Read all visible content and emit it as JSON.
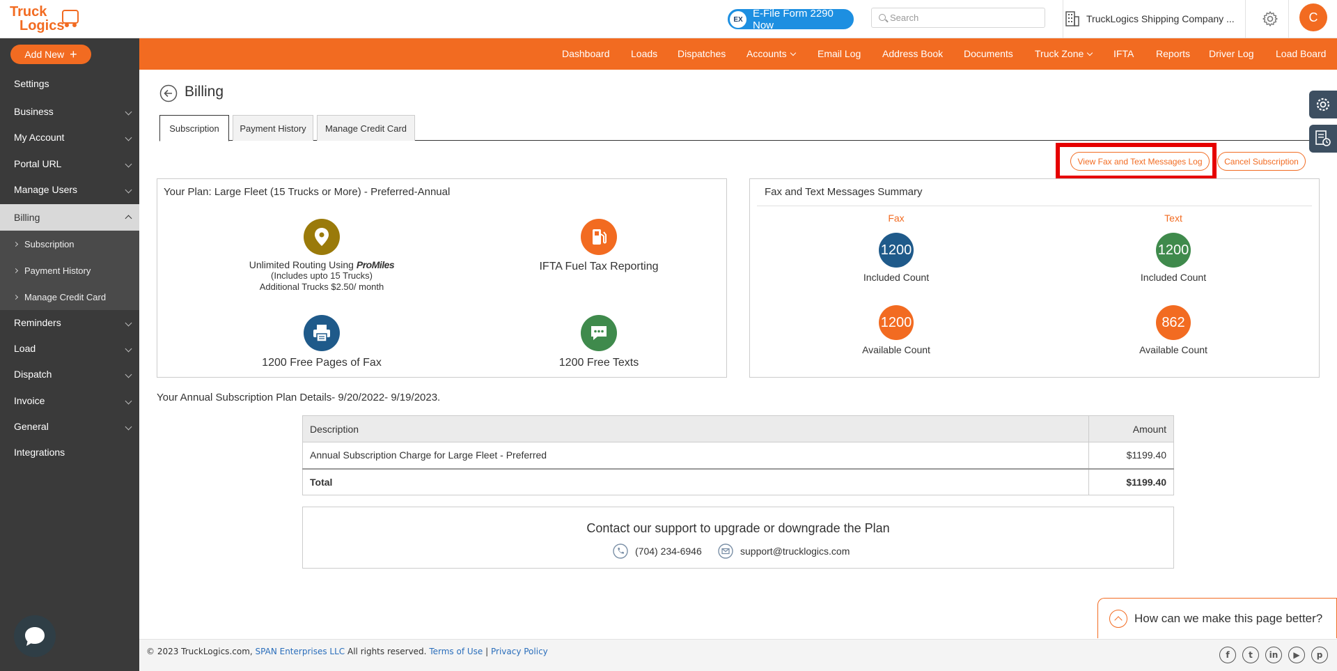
{
  "header": {
    "efile_label": "E-File Form 2290 Now",
    "search_placeholder": "Search",
    "company_name": "TruckLogics Shipping Company ...",
    "avatar_initial": "C"
  },
  "nav": {
    "items": [
      "Dashboard",
      "Loads",
      "Dispatches",
      "Accounts",
      "Email Log",
      "Address Book",
      "Documents",
      "Truck Zone",
      "IFTA",
      "Reports",
      "Driver Log",
      "Load Board"
    ]
  },
  "sidebar": {
    "add_new": "Add New",
    "items": [
      "Settings",
      "Business",
      "My Account",
      "Portal URL",
      "Manage Users",
      "Billing",
      "Reminders",
      "Load",
      "Dispatch",
      "Invoice",
      "General",
      "Integrations"
    ],
    "billing_subitems": [
      "Subscription",
      "Payment History",
      "Manage Credit Card"
    ]
  },
  "page": {
    "title": "Billing",
    "tabs": [
      "Subscription",
      "Payment History",
      "Manage Credit Card"
    ]
  },
  "actions": {
    "view_log": "View Fax and Text Messages Log",
    "cancel": "Cancel Subscription"
  },
  "plan": {
    "title": "Your Plan: Large Fleet (15 Trucks or More) - Preferred-Annual",
    "routing_main": "Unlimited Routing Using",
    "routing_brand": "ProMiles",
    "routing_line2": "(Includes upto 15 Trucks)",
    "routing_line3": "Additional Trucks $2.50/ month",
    "ifta": "IFTA Fuel Tax Reporting",
    "fax": "1200 Free Pages of Fax",
    "texts": "1200 Free Texts"
  },
  "summary": {
    "title": "Fax and Text Messages Summary",
    "fax_label": "Fax",
    "text_label": "Text",
    "fax_included": "1200",
    "text_included": "1200",
    "included_label": "Included Count",
    "fax_available": "1200",
    "text_available": "862",
    "available_label": "Available Count"
  },
  "details": {
    "heading": "Your Annual Subscription Plan Details- 9/20/2022- 9/19/2023.",
    "col_description": "Description",
    "col_amount": "Amount",
    "row_description": "Annual Subscription Charge for Large Fleet - Preferred",
    "row_amount": "$1199.40",
    "total_label": "Total",
    "total_amount": "$1199.40"
  },
  "contact": {
    "title": "Contact our support to upgrade or downgrade the Plan",
    "phone": "(704) 234-6946",
    "email": "support@trucklogics.com"
  },
  "feedback": {
    "label": "How can we make this page better?"
  },
  "footer": {
    "copyright": "© 2023 TruckLogics.com,",
    "company_link": "SPAN Enterprises LLC",
    "rights": "All rights reserved.",
    "terms": "Terms of Use",
    "privacy": "Privacy Policy"
  },
  "colors": {
    "brand_orange": "#f26b21",
    "sidebar_dark": "#3a3a3a",
    "blue_circle": "#1f5a8a",
    "green_circle": "#3f8a4c",
    "gold_circle": "#9a7a0a",
    "highlight_red": "#e60000"
  }
}
